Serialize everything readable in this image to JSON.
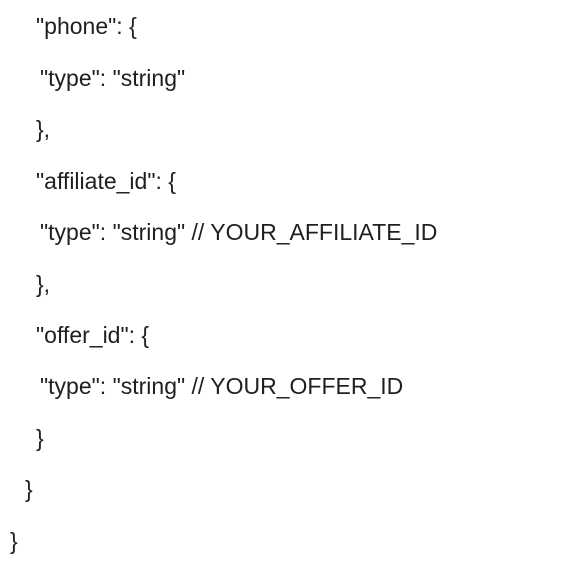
{
  "document": {
    "lines": [
      "\"phone\": {",
      "\"type\": \"string\"",
      "},",
      "\"affiliate_id\": {",
      "\"type\": \"string\" // YOUR_AFFILIATE_ID",
      "},",
      "\"offer_id\": {",
      "\"type\": \"string\" // YOUR_OFFER_ID",
      "}",
      "}",
      "}"
    ]
  }
}
